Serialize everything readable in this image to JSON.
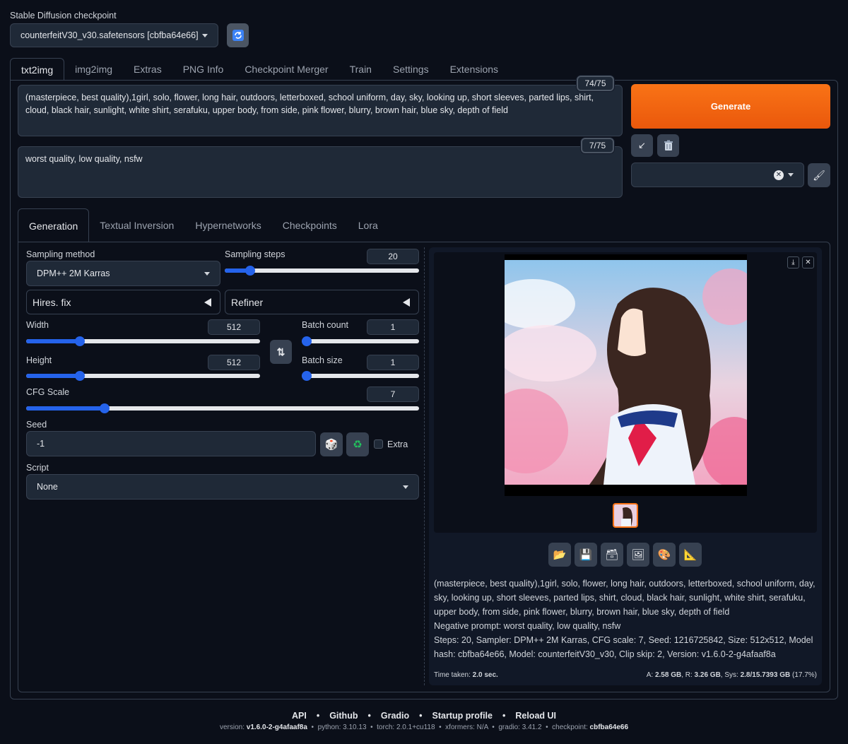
{
  "checkpoint": {
    "label": "Stable Diffusion checkpoint",
    "value": "counterfeitV30_v30.safetensors [cbfba64e66]",
    "refresh_icon": "refresh-icon"
  },
  "main_tabs": [
    "txt2img",
    "img2img",
    "Extras",
    "PNG Info",
    "Checkpoint Merger",
    "Train",
    "Settings",
    "Extensions"
  ],
  "prompt": {
    "text": "(masterpiece, best quality),1girl, solo, flower, long hair, outdoors, letterboxed, school uniform, day, sky, looking up, short sleeves, parted lips, shirt, cloud, black hair, sunlight, white shirt, serafuku, upper body, from side, pink flower, blurry, brown hair, blue sky, depth of field",
    "counter": "74/75"
  },
  "negative_prompt": {
    "text": "worst quality, low quality, nsfw",
    "counter": "7/75"
  },
  "generate_label": "Generate",
  "colors": {
    "accent": "#f97316",
    "slider": "#2563eb",
    "bg": "#0b0f19",
    "panel": "#1f2937"
  },
  "sub_tabs": [
    "Generation",
    "Textual Inversion",
    "Hypernetworks",
    "Checkpoints",
    "Lora"
  ],
  "sampling": {
    "method_label": "Sampling method",
    "method_value": "DPM++ 2M Karras",
    "steps_label": "Sampling steps",
    "steps_value": "20",
    "steps_fraction": 0.13
  },
  "hires_label": "Hires. fix",
  "refiner_label": "Refiner",
  "width": {
    "label": "Width",
    "value": "512",
    "fraction": 0.23
  },
  "height": {
    "label": "Height",
    "value": "512",
    "fraction": 0.23
  },
  "batch_count": {
    "label": "Batch count",
    "value": "1",
    "fraction": 0.0
  },
  "batch_size": {
    "label": "Batch size",
    "value": "1",
    "fraction": 0.0
  },
  "cfg": {
    "label": "CFG Scale",
    "value": "7",
    "fraction": 0.2
  },
  "seed": {
    "label": "Seed",
    "value": "-1",
    "extra_label": "Extra"
  },
  "script": {
    "label": "Script",
    "value": "None"
  },
  "output": {
    "info_prompt": "(masterpiece, best quality),1girl, solo, flower, long hair, outdoors, letterboxed, school uniform, day, sky, looking up, short sleeves, parted lips, shirt, cloud, black hair, sunlight, white shirt, serafuku, upper body, from side, pink flower, blurry, brown hair, blue sky, depth of field",
    "info_negative": "Negative prompt: worst quality, low quality, nsfw",
    "info_params": "Steps: 20, Sampler: DPM++ 2M Karras, CFG scale: 7, Seed: 1216725842, Size: 512x512, Model hash: cbfba64e66, Model: counterfeitV30_v30, Clip skip: 2, Version: v1.6.0-2-g4afaaf8a",
    "time_label": "Time taken:",
    "time_value": "2.0 sec.",
    "mem_a_label": "A:",
    "mem_a": "2.58 GB",
    "mem_r_label": "R:",
    "mem_r": "3.26 GB",
    "mem_sys_label": "Sys:",
    "mem_sys": "2.8/15.7393 GB",
    "mem_pct": "(17.7%)"
  },
  "footer": {
    "links": [
      "API",
      "Github",
      "Gradio",
      "Startup profile",
      "Reload UI"
    ],
    "version_label": "version:",
    "version": "v1.6.0-2-g4afaaf8a",
    "python_label": "python:",
    "python": "3.10.13",
    "torch_label": "torch:",
    "torch": "2.0.1+cu118",
    "xformers_label": "xformers:",
    "xformers": "N/A",
    "gradio_label": "gradio:",
    "gradio": "3.41.2",
    "checkpoint_label": "checkpoint:",
    "checkpoint": "cbfba64e66"
  }
}
